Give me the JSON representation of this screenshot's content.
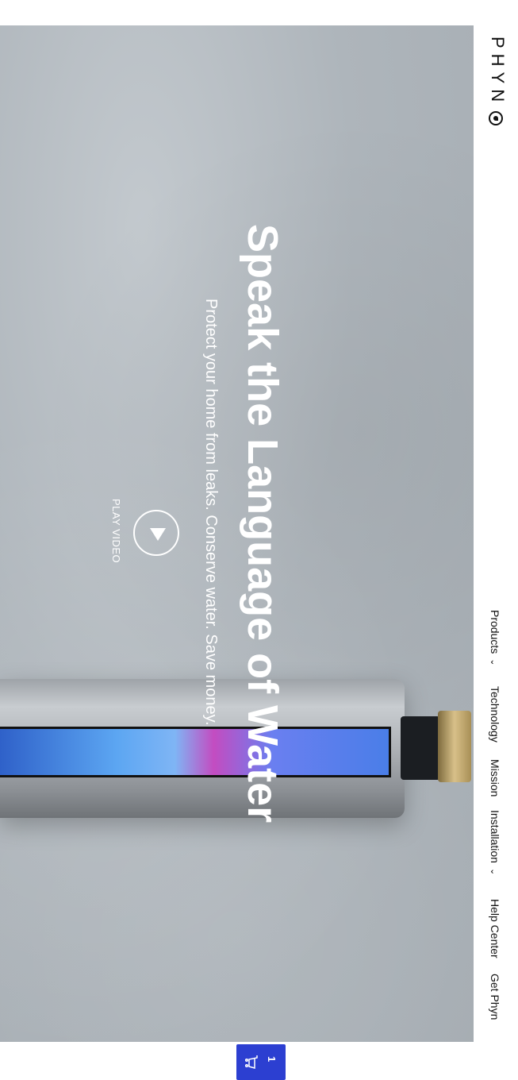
{
  "brand": {
    "logo_text": "PHYN"
  },
  "nav": {
    "items": [
      {
        "label": "Products",
        "has_dropdown": true
      },
      {
        "label": "Technology",
        "has_dropdown": false
      },
      {
        "label": "Mission",
        "has_dropdown": false
      },
      {
        "label": "Installation",
        "has_dropdown": true
      },
      {
        "label": "Help Center",
        "has_dropdown": false
      },
      {
        "label": "Get Phyn",
        "has_dropdown": false
      }
    ]
  },
  "hero": {
    "headline": "Speak the Language of Water",
    "subhead": "Protect your home from leaks. Conserve water. Save money.",
    "play_label": "PLAY VIDEO"
  },
  "cart": {
    "count": "1",
    "accent": "#2c3fd1"
  },
  "icons": {
    "play": "play-icon",
    "cart": "cart-icon",
    "chevron": "chevron-down-icon",
    "logo": "phyn-drop-icon"
  }
}
